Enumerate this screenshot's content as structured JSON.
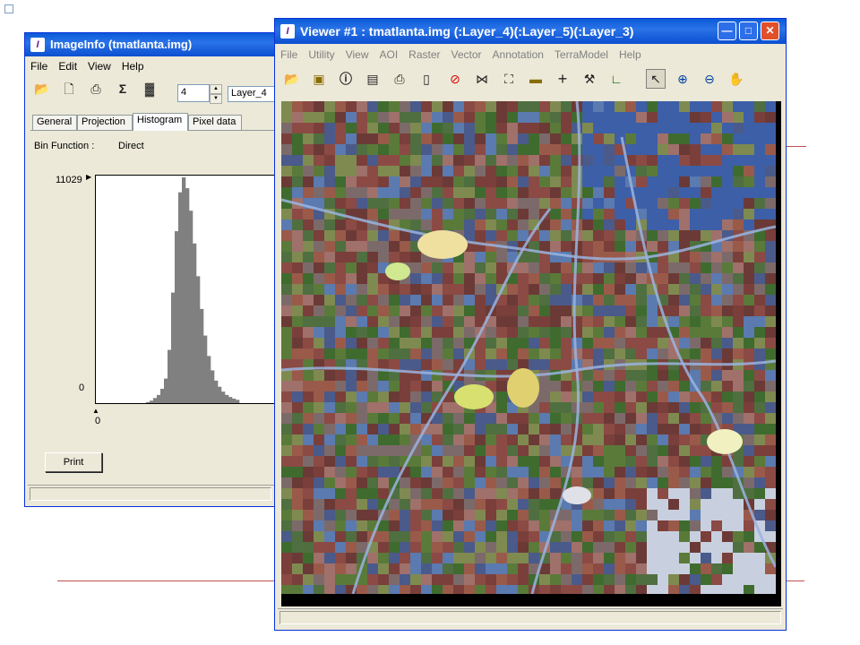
{
  "imageinfo": {
    "title": "ImageInfo (tmatlanta.img)",
    "menu": [
      "File",
      "Edit",
      "View",
      "Help"
    ],
    "toolbar_icons": [
      "open-folder-icon",
      "new-document-icon",
      "printer-icon",
      "sigma-icon",
      "histogram-icon"
    ],
    "layer_number": "4",
    "layer_name": "Layer_4",
    "tabs": [
      "General",
      "Projection",
      "Histogram",
      "Pixel data"
    ],
    "active_tab": "Histogram",
    "bin_function_label": "Bin Function :",
    "bin_function_value": "Direct",
    "print_label": "Print"
  },
  "viewer": {
    "title": "Viewer #1 : tmatlanta.img (:Layer_4)(:Layer_5)(:Layer_3)",
    "menu": [
      "File",
      "Utility",
      "View",
      "AOI",
      "Raster",
      "Vector",
      "Annotation",
      "TerraModel",
      "Help"
    ],
    "toolbar_icons": [
      "open-folder-icon",
      "open-layer-icon",
      "info-icon",
      "save-icon",
      "printer-icon",
      "eraser-icon",
      "clear-view-icon",
      "zoom-fit-icon",
      "zoom-extent-icon",
      "measure-icon",
      "inquire-cursor-icon",
      "hammer-icon",
      "profile-chart-icon",
      "pointer-icon",
      "zoom-in-icon",
      "zoom-out-icon",
      "pan-hand-icon"
    ],
    "window_buttons": [
      "minimize",
      "maximize",
      "close"
    ]
  },
  "chart_data": {
    "type": "area",
    "title": "",
    "xlabel": "",
    "ylabel": "",
    "ylim": [
      0,
      11029
    ],
    "y_tick_labels": [
      "11029",
      "0"
    ],
    "x_tick_labels": [
      "0"
    ],
    "x": [
      0,
      5,
      10,
      15,
      20,
      25,
      30,
      35,
      40,
      45,
      50,
      55,
      60,
      65,
      70,
      75,
      80,
      85,
      90,
      95,
      100,
      105,
      110,
      115,
      120,
      125,
      130,
      135,
      140,
      145,
      150,
      155,
      160,
      165,
      170,
      175,
      180,
      185,
      190,
      195
    ],
    "values": [
      0,
      0,
      0,
      0,
      0,
      0,
      0,
      0,
      0,
      0,
      0,
      0,
      0,
      0,
      50,
      120,
      250,
      400,
      700,
      1200,
      2600,
      5400,
      8400,
      10300,
      11029,
      10500,
      9400,
      7800,
      6200,
      4600,
      3300,
      2300,
      1600,
      1100,
      800,
      560,
      400,
      300,
      220,
      160
    ],
    "grid": false,
    "legend": "none",
    "fill_color": "#808080"
  }
}
